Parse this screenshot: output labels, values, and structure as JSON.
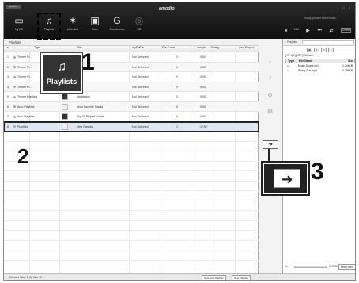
{
  "app": {
    "top_label": "EMOD-1",
    "brand": "emodio",
    "window_controls": "- □ ×"
  },
  "toolbar": {
    "items": [
      {
        "label": "My PC",
        "icon": "monitor-icon"
      },
      {
        "label": "Playlists",
        "icon": "playlist-icon"
      },
      {
        "label": "Unlimited",
        "icon": "antenna-icon"
      },
      {
        "label": "Store",
        "icon": "bag-icon"
      },
      {
        "label": "Emodio.com",
        "icon": "globe-icon"
      },
      {
        "label": "CD",
        "icon": "disc-icon"
      }
    ]
  },
  "player": {
    "now_playing": "Enjoy yourself with Emodio",
    "mini_label": "Delete"
  },
  "left": {
    "breadcrumb": "Playlists",
    "columns": [
      "Type",
      "Title",
      "myEMDe",
      "File Count",
      "Length",
      "Rating",
      "Last Played"
    ],
    "rows": [
      {
        "num": "1",
        "type": "Theme Pl...",
        "title": "",
        "my": "Not Selected",
        "count": "0",
        "length": "0:00"
      },
      {
        "num": "2",
        "type": "Theme Pl...",
        "title": "ty",
        "my": "Not Selected",
        "count": "0",
        "length": "0:00"
      },
      {
        "num": "3",
        "type": "Theme Pl...",
        "title": "ing",
        "my": "Not Selected",
        "count": "0",
        "length": "0:00"
      },
      {
        "num": "4",
        "type": "Theme Pl...",
        "title": "",
        "my": "Not Selected",
        "count": "0",
        "length": "0:00"
      },
      {
        "num": "5",
        "type": "Theme Playlists",
        "title": "Meditation",
        "my": "Not Selected",
        "count": "0",
        "length": "0:00"
      },
      {
        "num": "6",
        "type": "Auto Playlists",
        "title": "Most Favorite Tracks",
        "my": "Not Selected",
        "count": "0",
        "length": "0:00"
      },
      {
        "num": "7",
        "type": "Auto Playlists",
        "title": "Top 25 Played Tracks",
        "my": "Not Selected",
        "count": "0",
        "length": "0:00"
      },
      {
        "num": "8",
        "type": "Playlists",
        "title": "New Playlists",
        "my": "Not Selected",
        "count": "2",
        "length": "12:52"
      }
    ]
  },
  "right": {
    "search_label": "Playlists",
    "path": "[YP-Q1][MTP]3\\Music",
    "col_type": "Type",
    "col_name": "File Name",
    "col_size": "Size",
    "files": [
      {
        "name": "Music Space.mp3",
        "size": "1,344KB"
      },
      {
        "name": "Rising Sun.mp3",
        "size": "4,399KB"
      }
    ],
    "capacity": "929MB /...",
    "new_folder": "New Folder"
  },
  "status": {
    "left": "Selected lists : 1, All lists : 8",
    "btn1": "New Auto Playlists",
    "btn2": "New Playlists"
  },
  "callouts": {
    "playlists_label": "Playlists",
    "num1": "1",
    "num2": "2",
    "num3": "3"
  }
}
